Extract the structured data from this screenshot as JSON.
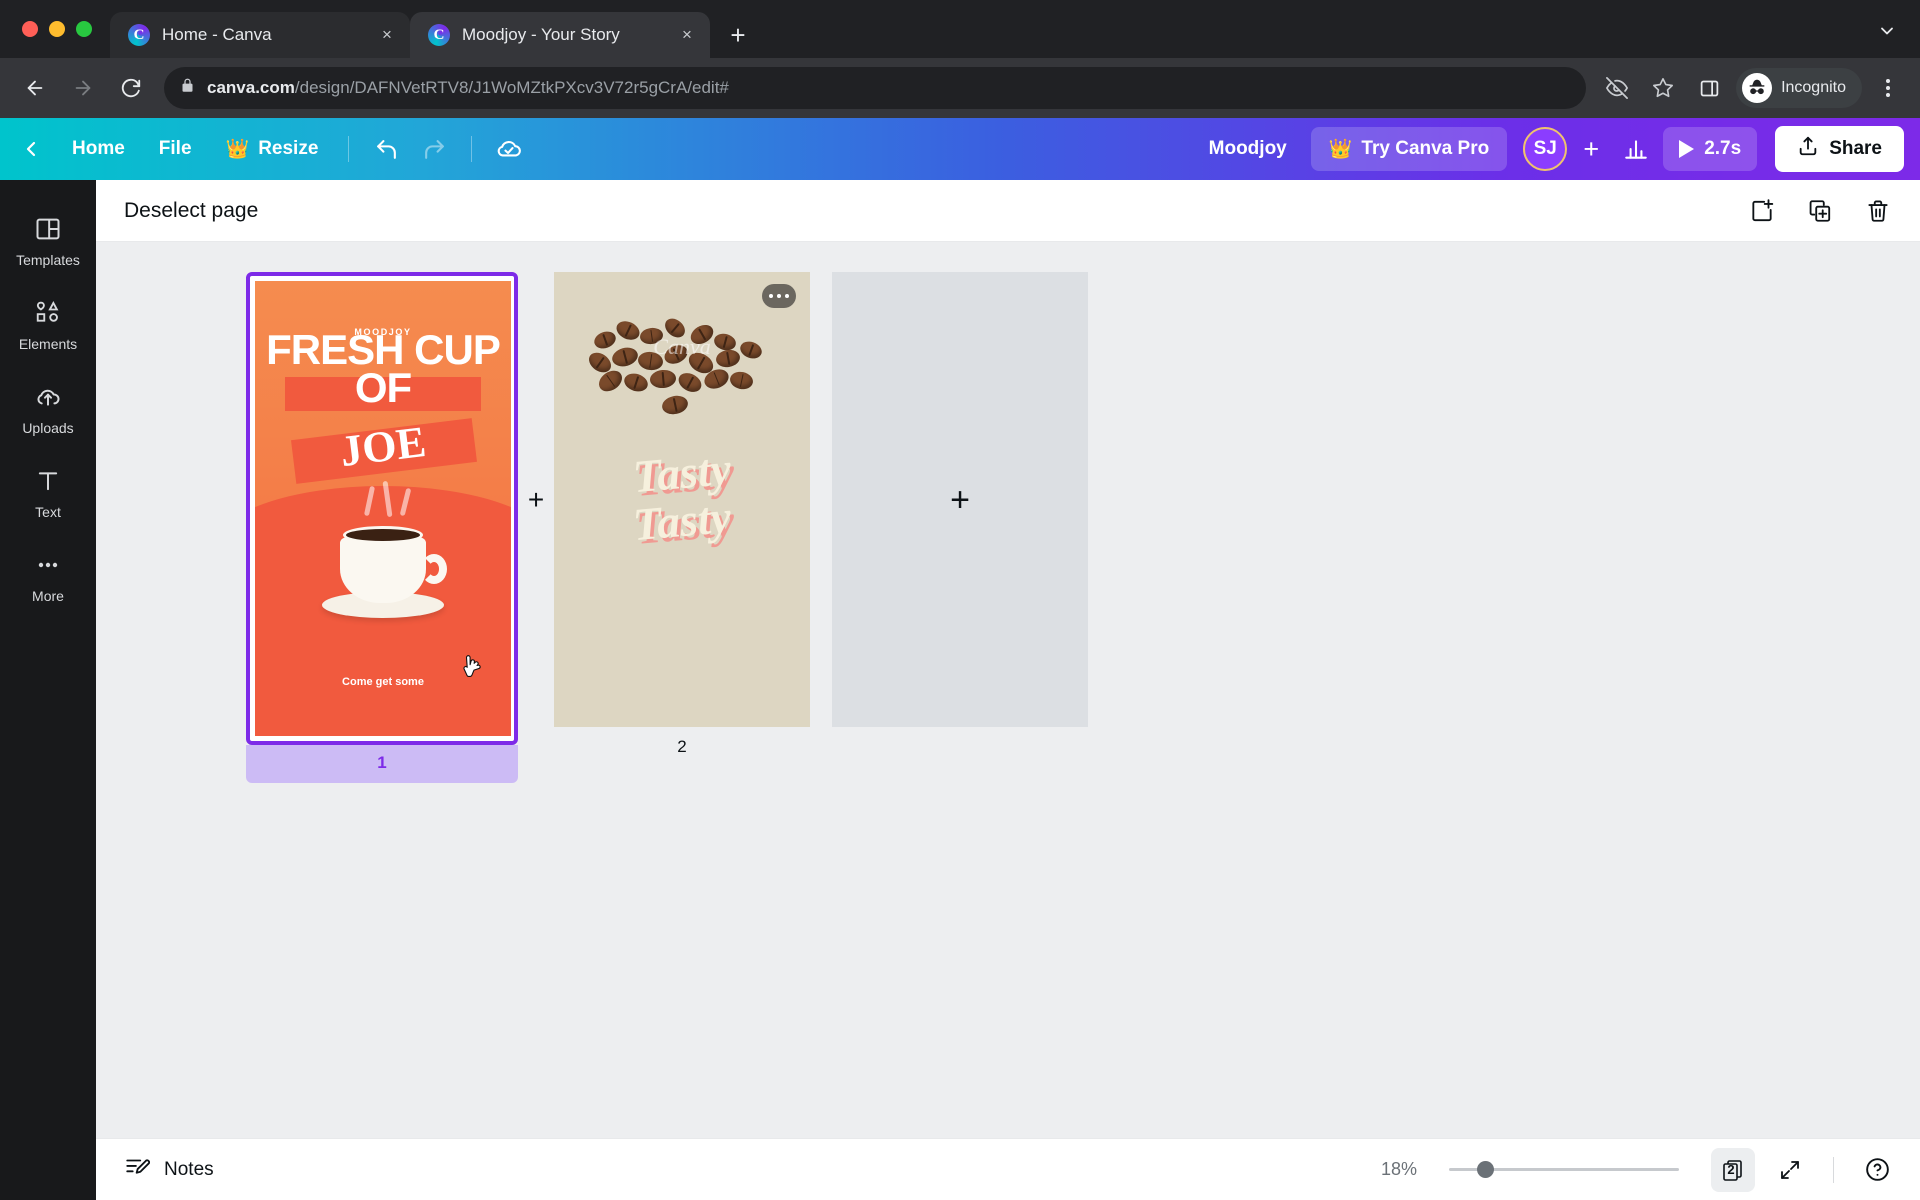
{
  "browser": {
    "window_controls": [
      "close",
      "minimize",
      "maximize"
    ],
    "tabs": [
      {
        "title": "Home - Canva",
        "favicon": "canva-icon",
        "active": false,
        "close_label": "×"
      },
      {
        "title": "Moodjoy - Your Story",
        "favicon": "canva-icon",
        "active": true,
        "close_label": "×"
      }
    ],
    "new_tab_label": "+",
    "tab_list_icon": "chevron-down-icon",
    "nav": {
      "back": "back-icon",
      "forward": "forward-icon",
      "reload": "reload-icon"
    },
    "omnibox": {
      "lock_icon": "lock-icon",
      "url_domain": "canva.com",
      "url_path": "/design/DAFNVetRTV8/J1WoMZtkPXcv3V72r5gCrA/edit#",
      "url_full": "canva.com/design/DAFNVetRTV8/J1WoMZtkPXcv3V72r5gCrA/edit#"
    },
    "toolbar_actions": [
      "eye-off-icon",
      "star-icon",
      "side-panel-icon"
    ],
    "profile": {
      "label": "Incognito",
      "icon": "incognito-icon"
    },
    "menu_icon": "kebab-menu-icon"
  },
  "canva": {
    "header": {
      "back_icon": "chevron-left-icon",
      "home_label": "Home",
      "file_label": "File",
      "resize_label": "Resize",
      "resize_badge": "crown-icon",
      "undo_icon": "undo-icon",
      "redo_icon": "redo-icon",
      "sync_icon": "cloud-check-icon",
      "doc_title": "Moodjoy",
      "try_pro_label": "Try Canva Pro",
      "try_pro_badge": "crown-icon",
      "avatar_initials": "SJ",
      "add_collaborator_label": "+",
      "animate_icon": "bar-chart-icon",
      "timer_label": "2.7s",
      "play_icon": "play-icon",
      "share_label": "Share",
      "share_icon": "share-upload-icon"
    },
    "sidebar": {
      "items": [
        {
          "label": "Templates",
          "icon": "templates-icon"
        },
        {
          "label": "Elements",
          "icon": "elements-icon"
        },
        {
          "label": "Uploads",
          "icon": "uploads-cloud-icon"
        },
        {
          "label": "Text",
          "icon": "text-t-icon"
        },
        {
          "label": "More",
          "icon": "more-dots-icon"
        }
      ]
    },
    "page_toolbar": {
      "deselect_label": "Deselect page",
      "actions": [
        {
          "name": "add-page-icon",
          "tooltip": "Add page"
        },
        {
          "name": "duplicate-page-icon",
          "tooltip": "Duplicate page"
        },
        {
          "name": "delete-page-icon",
          "tooltip": "Delete page"
        }
      ]
    },
    "pages": [
      {
        "number": "1",
        "selected": true,
        "design": {
          "brand": "MOODJOY",
          "headline_line1": "FRESH CUP",
          "headline_line2": "OF",
          "headline_line3": "JOE",
          "cta": "Come get some",
          "bg_color": "#f47b47",
          "accent_color": "#f15a3e"
        }
      },
      {
        "number": "2",
        "selected": false,
        "options_icon": "more-options-icon",
        "design": {
          "headline_line1": "Tasty",
          "headline_line2": "Tasty",
          "watermark": "Canva",
          "bg_color": "#ddd6c2",
          "text_color": "#f6f0dd",
          "shadow_color": "#f09a92"
        }
      }
    ],
    "add_page_between_label": "+",
    "empty_page_add_label": "+",
    "bottom_bar": {
      "notes_label": "Notes",
      "notes_icon": "notes-icon",
      "zoom_level": "18%",
      "page_count": "2",
      "page_count_icon": "pages-stack-icon",
      "fullscreen_icon": "expand-icon",
      "help_icon": "help-question-icon"
    },
    "colors": {
      "brand_teal": "#00c4cc",
      "brand_purple": "#7d2ae8",
      "selection_purple": "#7d2ae8",
      "selection_bar": "#ccbbf5"
    }
  }
}
